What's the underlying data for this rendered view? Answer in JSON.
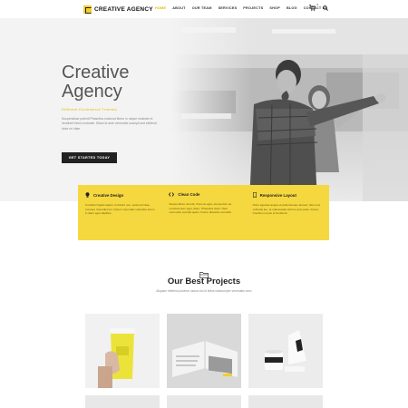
{
  "brand": {
    "name": "CREATIVE AGENCY"
  },
  "nav": {
    "items": [
      "HOME",
      "ABOUT",
      "OUR TEAM",
      "SERVICES",
      "PROJECTS",
      "SHOP",
      "BLOG",
      "CONTACT US"
    ],
    "active": "HOME",
    "cart_count": "0"
  },
  "hero": {
    "title_line1": "Creative",
    "title_line2": "Agency",
    "subtitle": "Different Ecommerce Themes",
    "description": "Suspendisse potenti Phasellus euismod libero in neque molestie et hendrerit libero molestie. Etiam id ante venenatis suscipit sed eleifend dolor mi vitae.",
    "button_label": "GET STARTED TODAY"
  },
  "features": [
    {
      "icon": "lightbulb-icon",
      "title": "Creative Design",
      "text": "Curabitur ligula sapien, tincidunt non, euismod vitae, posuere imperdiet leo. Donec venenatis vulputate lorem in diam eget dapibus."
    },
    {
      "icon": "code-icon",
      "title": "Clean Code",
      "text": "Suspendisse nisl elit, rhoncus eget, elementum ac, condimentum eget, diam. Phasellus dolor. Nam commodo suscipit quam. Fusce pharetra convallis."
    },
    {
      "icon": "mobile-icon",
      "title": "Responsive Layout",
      "text": "Nunc egestas augue at pellentesque laoreet, felis eros vehicula leo, at malesuada velit leo quis pede. Donec interdum metus et hendrerit."
    }
  ],
  "projects": {
    "icon": "folder-icon",
    "title": "Our Best Projects",
    "subtitle": "Aliquam eleifend pulvinar luctus nisi id tellus ullamcorper venenatis nunc"
  },
  "colors": {
    "accent": "#f2cf2c",
    "dark": "#222222"
  }
}
